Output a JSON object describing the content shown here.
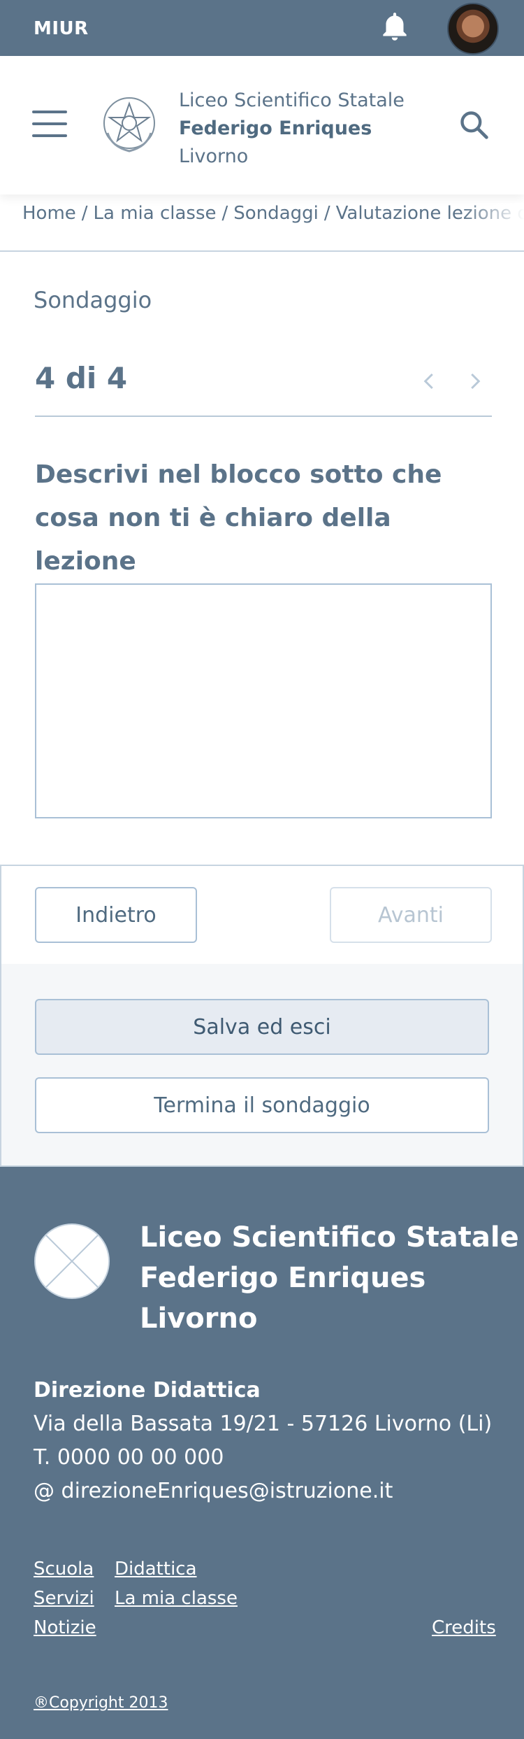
{
  "topbar": {
    "brand": "MIUR",
    "icons": {
      "notifications": "bell-icon",
      "user": "avatar"
    }
  },
  "header": {
    "school_line1": "Liceo Scientifico Statale",
    "school_line2": "Federigo Enriques",
    "school_line3": "Livorno",
    "icons": {
      "menu": "hamburger-icon",
      "emblem": "emblem-icon",
      "search": "search-icon"
    }
  },
  "breadcrumb": {
    "items": [
      "Home",
      "La mia classe",
      "Sondaggi",
      "Valutazione lezione di cl"
    ],
    "separator": "/"
  },
  "survey": {
    "label": "Sondaggio",
    "counter": "4 di 4",
    "question": "Descrivi nel blocco sotto che cosa non ti è chiaro della lezione",
    "answer_value": ""
  },
  "buttons": {
    "back": "Indietro",
    "next": "Avanti",
    "save": "Salva ed esci",
    "end": "Termina il sondaggio"
  },
  "footer": {
    "title_line1": "Liceo Scientifico Statale",
    "title_line2": "Federigo Enriques",
    "title_line3": "Livorno",
    "office": "Direzione Didattica",
    "address": "Via della Bassata 19/21 - 57126 Livorno (Li)",
    "phone": "T. 0000 00 00 000",
    "email": "@ direzioneEnriques@istruzione.it",
    "links": {
      "scuola": "Scuola",
      "didattica": "Didattica",
      "servizi": "Servizi",
      "la_mia_classe": "La mia classe",
      "notizie": "Notizie",
      "credits": "Credits"
    },
    "copyright": "®Copyright 2013"
  },
  "colors": {
    "primary": "#5b7389",
    "border": "#c7d4e0",
    "save_bg": "#e6ebf2",
    "disabled_text": "#b7c5d2"
  }
}
